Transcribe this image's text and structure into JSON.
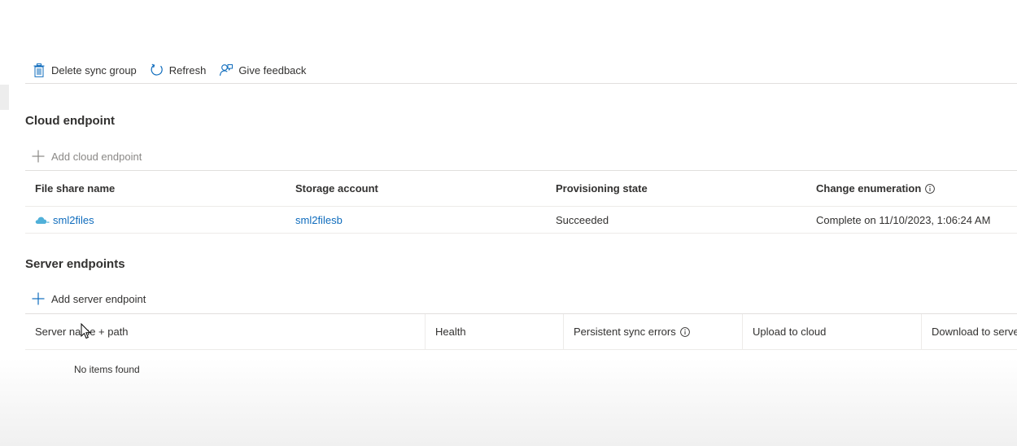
{
  "toolbar": {
    "delete_label": "Delete sync group",
    "delete_icon": "trash-icon",
    "refresh_label": "Refresh",
    "refresh_icon": "refresh-icon",
    "feedback_label": "Give feedback",
    "feedback_icon": "feedback-icon"
  },
  "cloud": {
    "title": "Cloud endpoint",
    "add_label": "Add cloud endpoint",
    "columns": [
      "File share name",
      "Storage account",
      "Provisioning state",
      "Change enumeration"
    ],
    "rows": [
      {
        "file_share": "sml2files",
        "storage_account": "sml2filesb",
        "provisioning_state": "Succeeded",
        "change_enumeration": "Complete on 11/10/2023, 1:06:24 AM"
      }
    ]
  },
  "server": {
    "title": "Server endpoints",
    "add_label": "Add server endpoint",
    "columns": [
      "Server name + path",
      "Health",
      "Persistent sync errors",
      "Upload to cloud",
      "Download to server"
    ],
    "empty_text": "No items found"
  },
  "colors": {
    "link": "#0f6cbd",
    "text": "#323130",
    "disabled": "#8a8886",
    "icon_blue": "#0f6cbd",
    "cloud_icon": "#50b0d9"
  }
}
